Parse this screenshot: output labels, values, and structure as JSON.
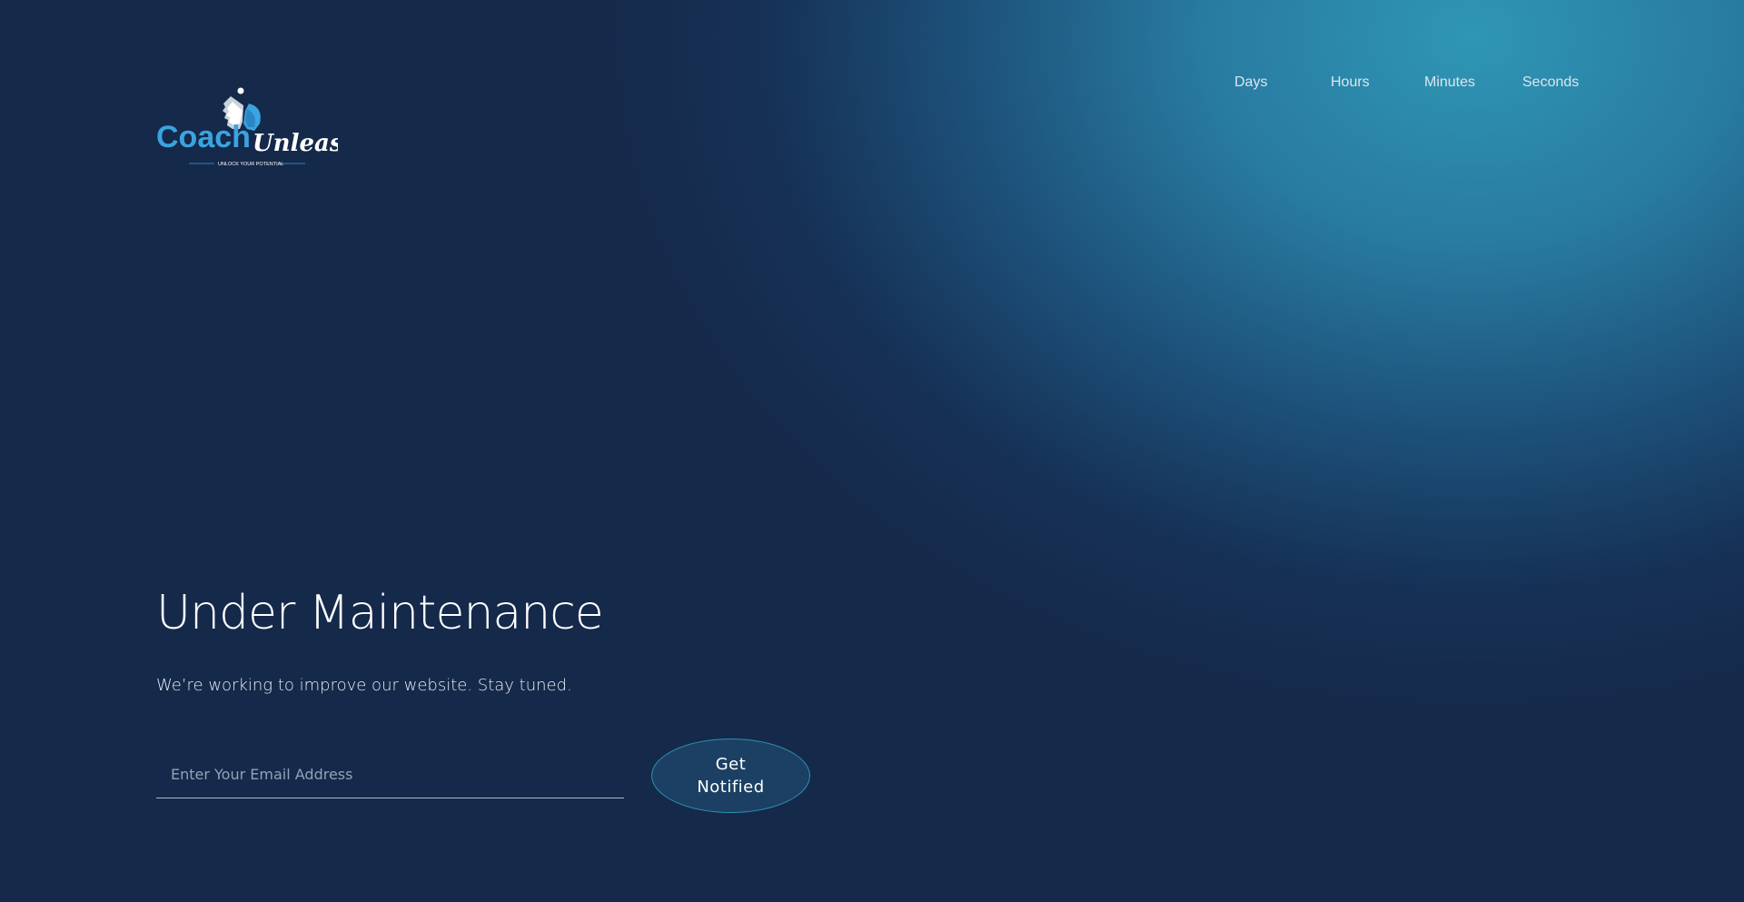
{
  "logo": {
    "brand_primary": "Coach",
    "brand_secondary": "Unleash",
    "tagline": "UNLOCK YOUR POTENTIAL",
    "icon": "two-faces-profile-icon"
  },
  "countdown": {
    "days_label": "Days",
    "hours_label": "Hours",
    "minutes_label": "Minutes",
    "seconds_label": "Seconds"
  },
  "main": {
    "title": "Under Maintenance",
    "subtitle": "We’re working to improve our website. Stay tuned.",
    "email_placeholder": "Enter Your Email Address",
    "email_value": "",
    "notify_button": "Get Notified"
  },
  "colors": {
    "background": "#15294a",
    "glow": "#2f96b4",
    "accent_blue": "#3aa4e0",
    "button_fill": "#1b4063",
    "button_border": "#2f8fae"
  }
}
